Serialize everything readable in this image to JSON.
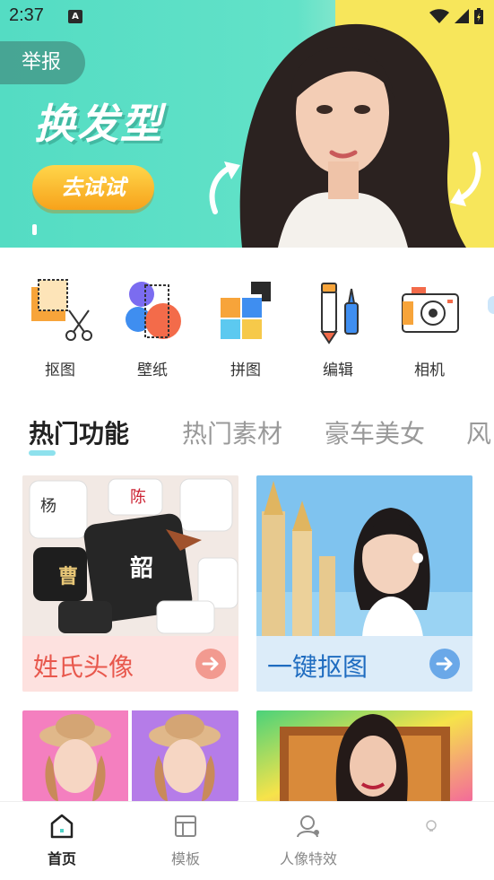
{
  "status_bar": {
    "time": "2:37",
    "indicator": "A"
  },
  "banner": {
    "report_label": "举报",
    "title": "换发型",
    "cta_label": "去试试"
  },
  "tools": [
    {
      "label": "抠图",
      "icon": "cutout-icon"
    },
    {
      "label": "壁纸",
      "icon": "wallpaper-icon"
    },
    {
      "label": "拼图",
      "icon": "puzzle-icon"
    },
    {
      "label": "编辑",
      "icon": "edit-icon"
    },
    {
      "label": "相机",
      "icon": "camera-icon"
    }
  ],
  "tabs": [
    {
      "label": "热门功能",
      "active": true
    },
    {
      "label": "热门素材",
      "active": false
    },
    {
      "label": "豪车美女",
      "active": false
    },
    {
      "label": "风",
      "active": false
    }
  ],
  "cards": [
    {
      "label": "姓氏头像",
      "label_color": "#e8584d",
      "bg": "#fde1df",
      "arrow_color": "#f29a90"
    },
    {
      "label": "一键抠图",
      "label_color": "#1f6cc0",
      "bg": "#dcecf9",
      "arrow_color": "#6aa8e8"
    }
  ],
  "bottom_nav": [
    {
      "label": "首页",
      "icon": "home-icon",
      "active": true
    },
    {
      "label": "模板",
      "icon": "template-icon",
      "active": false
    },
    {
      "label": "人像特效",
      "icon": "portrait-effect-icon",
      "active": false
    }
  ]
}
